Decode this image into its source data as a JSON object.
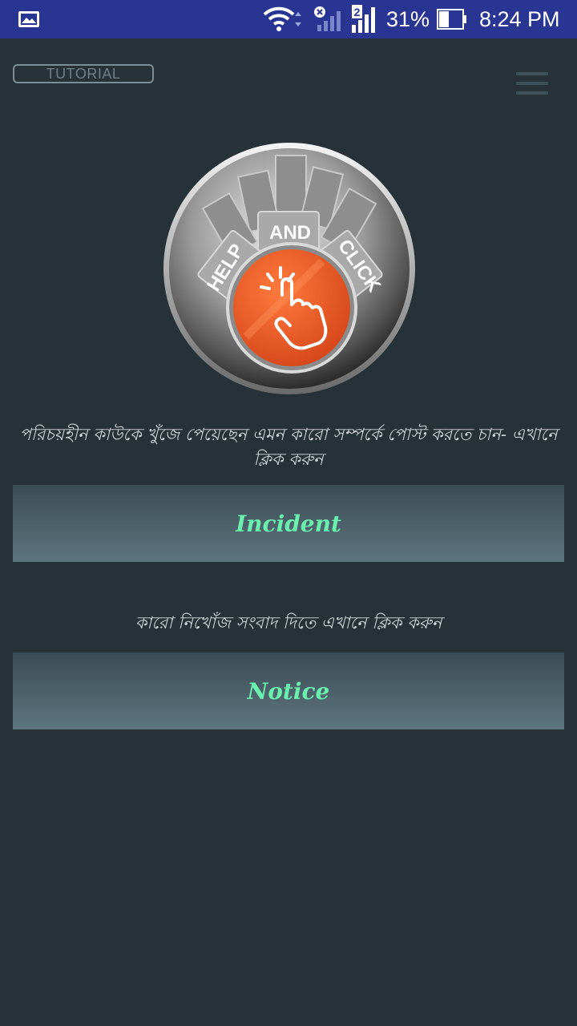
{
  "status_bar": {
    "battery_percent": "31%",
    "time": "8:24 PM",
    "sim2_label": "2",
    "icons": [
      "gallery-icon",
      "wifi-icon",
      "signal-off-icon",
      "signal-icon",
      "battery-icon"
    ]
  },
  "header": {
    "tutorial_label": "TUTORIAL",
    "menu_icon": "hamburger-menu-icon"
  },
  "logo": {
    "word_help": "HELP",
    "word_and": "AND",
    "word_click": "CLICK",
    "accent_color": "#e8521f"
  },
  "main": {
    "incident_caption": "পরিচয়হীন কাউকে খুঁজে পেয়েছেন এমন কারো সম্পর্কে পোস্ট করতে চান- এখানে ক্লিক করুন",
    "incident_label": "Incident",
    "notice_caption": "কারো নিখোঁজ সংবাদ দিতে এখানে ক্লিক করুন",
    "notice_label": "Notice",
    "button_text_color": "#69f0ae"
  }
}
